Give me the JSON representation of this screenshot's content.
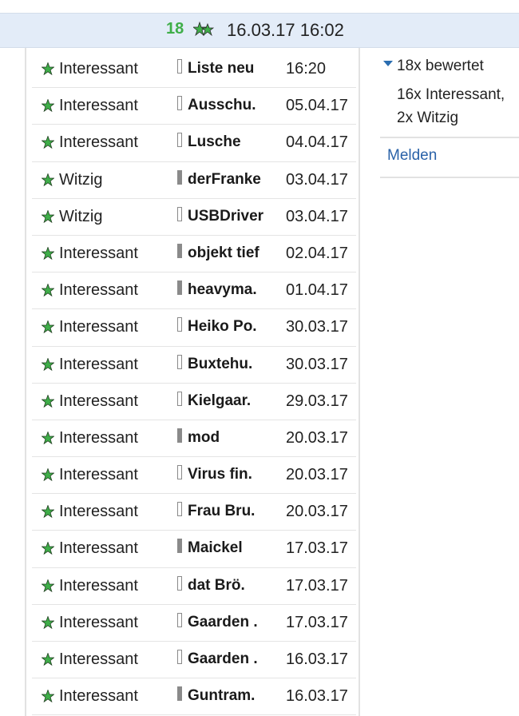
{
  "header": {
    "rating_count": "18",
    "stars_icon": "double-star-icon",
    "datetime": "16.03.17 16:02"
  },
  "ratings": [
    {
      "rating": "Interessant",
      "user": "Liste neu",
      "date": "16:20",
      "badge": "outline"
    },
    {
      "rating": "Interessant",
      "user": "Ausschu.",
      "date": "05.04.17",
      "badge": "outline"
    },
    {
      "rating": "Interessant",
      "user": "Lusche",
      "date": "04.04.17",
      "badge": "outline"
    },
    {
      "rating": "Witzig",
      "user": "derFranke",
      "date": "03.04.17",
      "badge": "filled"
    },
    {
      "rating": "Witzig",
      "user": "USBDriver",
      "date": "03.04.17",
      "badge": "outline"
    },
    {
      "rating": "Interessant",
      "user": "objekt tief",
      "date": "02.04.17",
      "badge": "filled"
    },
    {
      "rating": "Interessant",
      "user": "heavyma.",
      "date": "01.04.17",
      "badge": "filled"
    },
    {
      "rating": "Interessant",
      "user": "Heiko Po.",
      "date": "30.03.17",
      "badge": "outline"
    },
    {
      "rating": "Interessant",
      "user": "Buxtehu.",
      "date": "30.03.17",
      "badge": "outline"
    },
    {
      "rating": "Interessant",
      "user": "Kielgaar.",
      "date": "29.03.17",
      "badge": "outline"
    },
    {
      "rating": "Interessant",
      "user": "mod",
      "date": "20.03.17",
      "badge": "filled"
    },
    {
      "rating": "Interessant",
      "user": "Virus fin.",
      "date": "20.03.17",
      "badge": "outline"
    },
    {
      "rating": "Interessant",
      "user": "Frau Bru.",
      "date": "20.03.17",
      "badge": "outline"
    },
    {
      "rating": "Interessant",
      "user": "Maickel",
      "date": "17.03.17",
      "badge": "filled"
    },
    {
      "rating": "Interessant",
      "user": "dat Brö.",
      "date": "17.03.17",
      "badge": "outline"
    },
    {
      "rating": "Interessant",
      "user": "Gaarden .",
      "date": "17.03.17",
      "badge": "outline"
    },
    {
      "rating": "Interessant",
      "user": "Gaarden .",
      "date": "16.03.17",
      "badge": "outline"
    },
    {
      "rating": "Interessant",
      "user": "Guntram.",
      "date": "16.03.17",
      "badge": "filled"
    }
  ],
  "sidebar": {
    "summary_label": "18x bewertet",
    "summary_line1": "16x Interessant,",
    "summary_line2": "2x Witzig",
    "report_label": "Melden"
  },
  "colors": {
    "accent_green": "#3fae49",
    "link_blue": "#2a62a8",
    "header_bg": "#e3ecf8"
  }
}
